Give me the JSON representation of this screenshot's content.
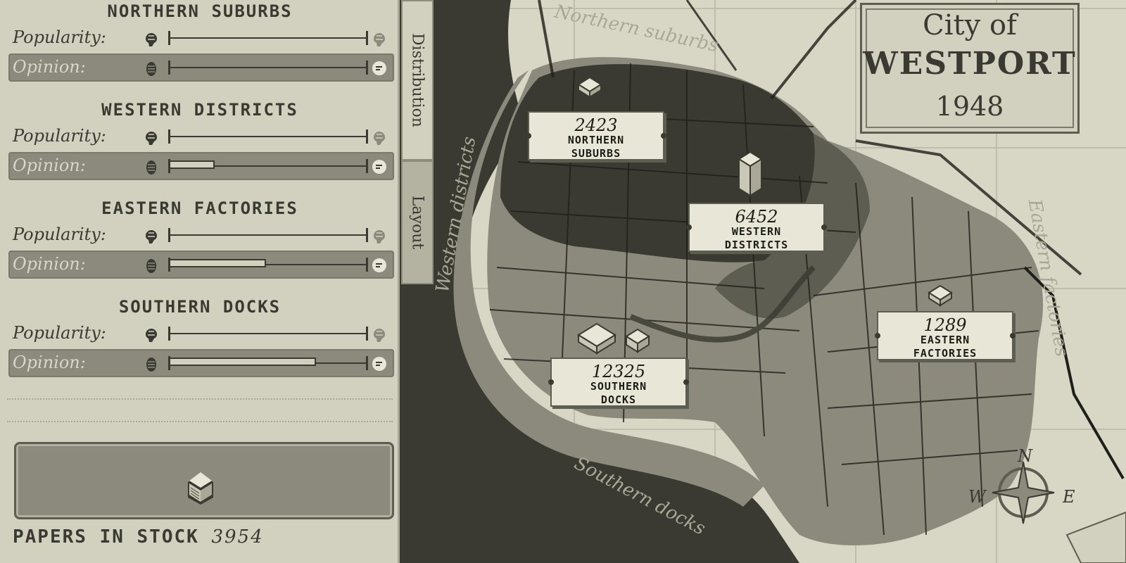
{
  "panel": {
    "regions": [
      {
        "title": "NORTHERN SUBURBS",
        "popularity_label": "Popularity:",
        "opinion_label": "Opinion:",
        "popularity": 0.0,
        "opinion": 0.0
      },
      {
        "title": "WESTERN DISTRICTS",
        "popularity_label": "Popularity:",
        "opinion_label": "Opinion:",
        "popularity": 0.0,
        "opinion": 0.23
      },
      {
        "title": "EASTERN FACTORIES",
        "popularity_label": "Popularity:",
        "opinion_label": "Opinion:",
        "popularity": 0.0,
        "opinion": 0.49
      },
      {
        "title": "SOUTHERN DOCKS",
        "popularity_label": "Popularity:",
        "opinion_label": "Opinion:",
        "popularity": 0.0,
        "opinion": 0.74
      }
    ],
    "stock_label": "PAPERS IN STOCK",
    "stock_value": "3954"
  },
  "tabs": {
    "distribution": "Distribution",
    "layout": "Layout"
  },
  "map": {
    "title_top": "City of",
    "title_city": "WESTPORT",
    "title_year": "1948",
    "labels": {
      "northern": "Northern suburbs",
      "western": "Western districts",
      "eastern": "Eastern factories",
      "southern": "Southern docks"
    },
    "plaques": [
      {
        "number": "2423",
        "name_1": "NORTHERN",
        "name_2": "SUBURBS"
      },
      {
        "number": "6452",
        "name_1": "WESTERN",
        "name_2": "DISTRICTS"
      },
      {
        "number": "1289",
        "name_1": "EASTERN",
        "name_2": "FACTORIES"
      },
      {
        "number": "12325",
        "name_1": "SOUTHERN",
        "name_2": "DOCKS"
      }
    ],
    "compass": {
      "n": "N",
      "w": "W",
      "e": "E"
    }
  },
  "colors": {
    "panel": "#d2d0bf",
    "ink": "#3a3a32",
    "dark_map": "#3b3a32",
    "mid_map": "#8b8a7c"
  },
  "icons": {
    "popularity_left": "brain-icon",
    "popularity_right": "brain-full-icon",
    "opinion_left": "hand-icon",
    "opinion_right": "thumbs-icon",
    "stock": "newspaper-stack-icon"
  }
}
